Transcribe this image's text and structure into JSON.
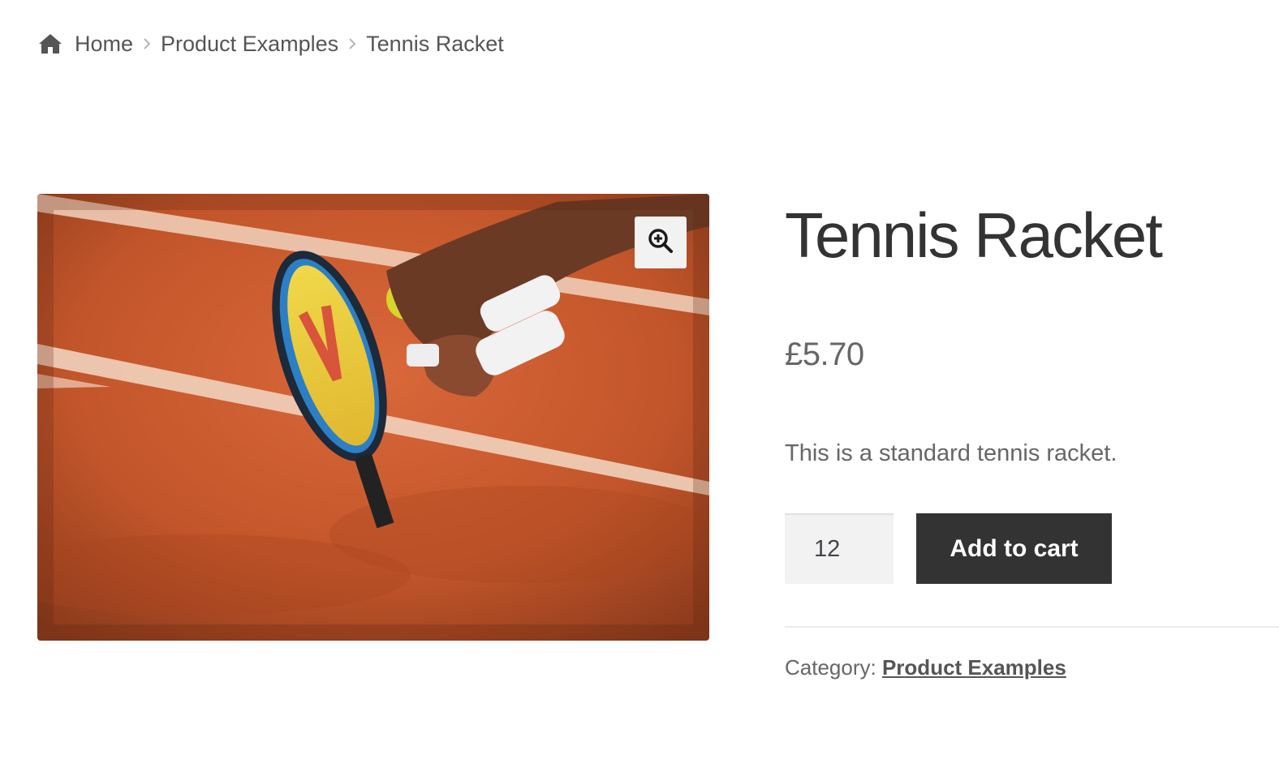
{
  "breadcrumb": {
    "home_icon": "home-icon",
    "items": [
      {
        "label": "Home"
      },
      {
        "label": "Product Examples"
      },
      {
        "label": "Tennis Racket"
      }
    ],
    "separator_icon": "chevron-right-icon"
  },
  "product": {
    "title": "Tennis Racket",
    "price": "£5.70",
    "description": "This is a standard tennis racket.",
    "image_icon": "zoom-in-icon"
  },
  "cart": {
    "quantity": "12",
    "add_label": "Add to cart"
  },
  "meta": {
    "category_label": "Category:",
    "category_value": "Product Examples"
  },
  "colors": {
    "button_bg": "#333333",
    "clay": "#c85a2a",
    "text": "#666666"
  }
}
